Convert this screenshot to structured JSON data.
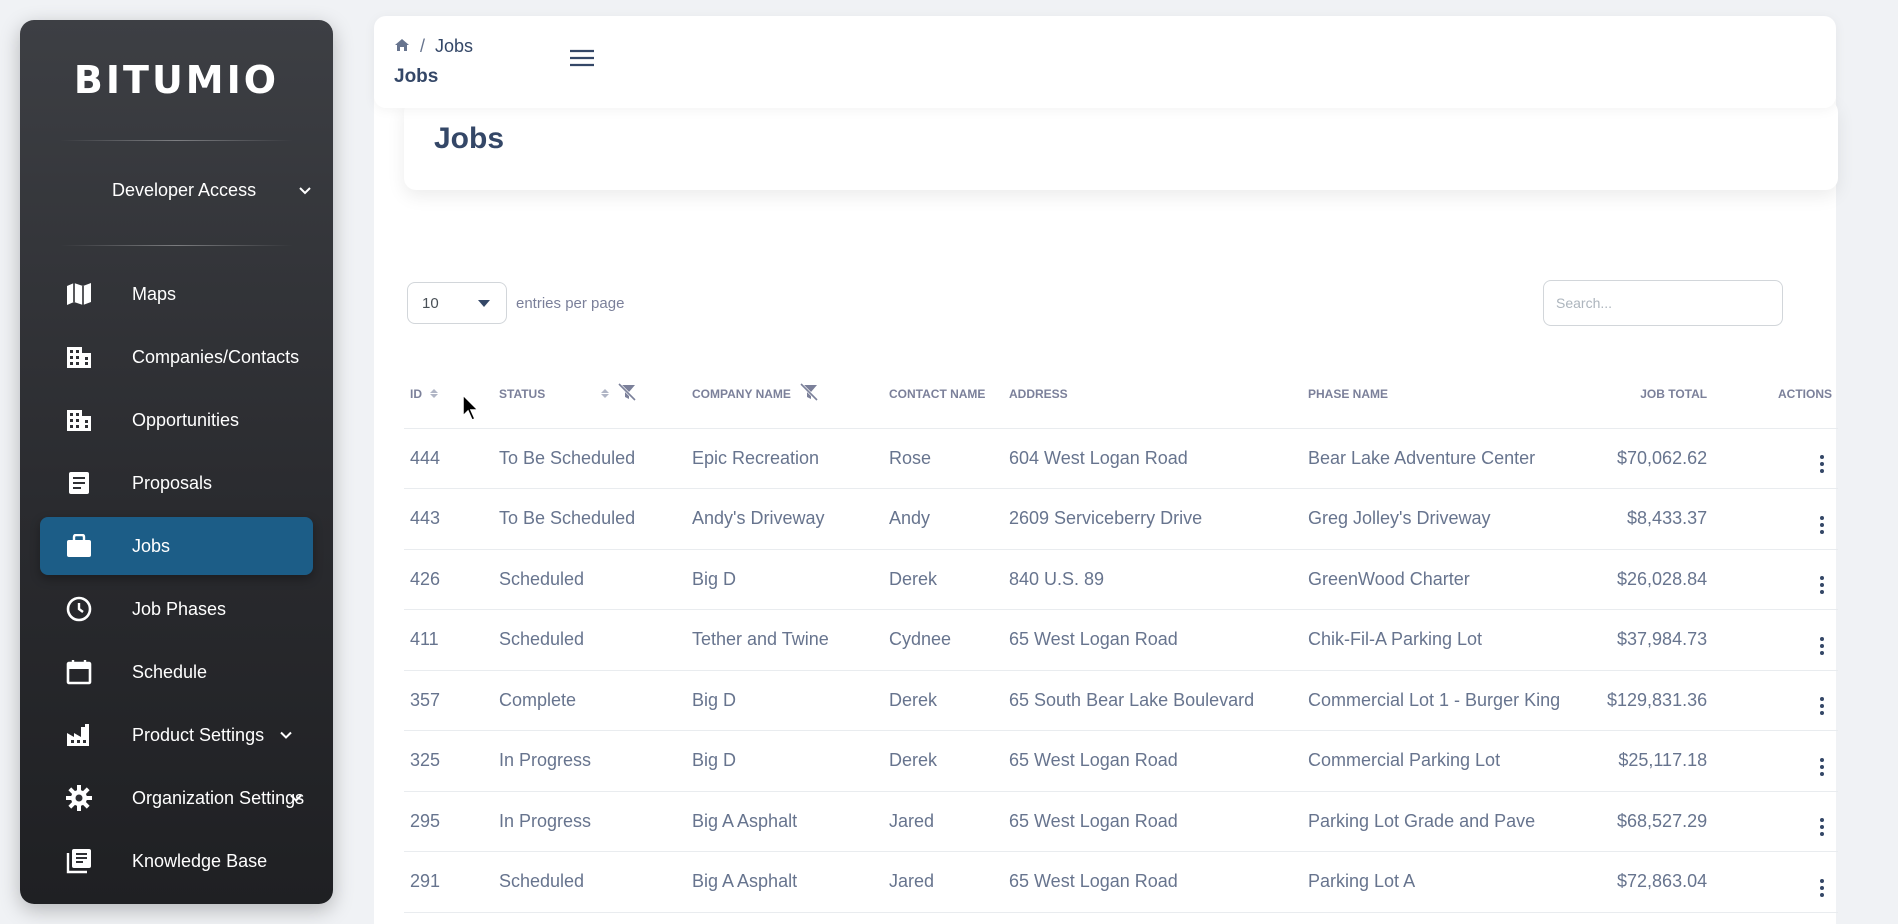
{
  "sidebar": {
    "brand": "BITUMIO",
    "access": {
      "label": "Developer Access"
    },
    "items": [
      {
        "label": "Maps",
        "icon": "map-icon"
      },
      {
        "label": "Companies/Contacts",
        "icon": "building-icon"
      },
      {
        "label": "Opportunities",
        "icon": "building-icon"
      },
      {
        "label": "Proposals",
        "icon": "document-icon"
      },
      {
        "label": "Jobs",
        "icon": "briefcase-icon",
        "active": true
      },
      {
        "label": "Job Phases",
        "icon": "clock-icon"
      },
      {
        "label": "Schedule",
        "icon": "calendar-icon"
      },
      {
        "label": "Product Settings",
        "icon": "factory-icon",
        "expandable": true
      },
      {
        "label": "Organization Settings",
        "icon": "gear-icon",
        "expandable": true
      },
      {
        "label": "Knowledge Base",
        "icon": "library-icon"
      }
    ]
  },
  "topbar": {
    "breadcrumb_current": "Jobs",
    "page_title": "Jobs"
  },
  "main": {
    "title": "Jobs",
    "entries_value": "10",
    "entries_label": "entries per page",
    "search_placeholder": "Search..."
  },
  "table": {
    "columns": [
      "ID",
      "STATUS",
      "COMPANY NAME",
      "CONTACT NAME",
      "ADDRESS",
      "PHASE NAME",
      "JOB TOTAL",
      "ACTIONS"
    ],
    "rows": [
      [
        "444",
        "To Be Scheduled",
        "Epic Recreation",
        "Rose",
        "604 West Logan Road",
        "Bear Lake Adventure Center",
        "$70,062.62"
      ],
      [
        "443",
        "To Be Scheduled",
        "Andy's Driveway",
        "Andy",
        "2609 Serviceberry Drive",
        "Greg Jolley's Driveway",
        "$8,433.37"
      ],
      [
        "426",
        "Scheduled",
        "Big D",
        "Derek",
        "840 U.S. 89",
        "GreenWood Charter",
        "$26,028.84"
      ],
      [
        "411",
        "Scheduled",
        "Tether and Twine",
        "Cydnee",
        "65 West Logan Road",
        "Chik-Fil-A Parking Lot",
        "$37,984.73"
      ],
      [
        "357",
        "Complete",
        "Big D",
        "Derek",
        "65 South Bear Lake Boulevard",
        "Commercial Lot 1 - Burger King",
        "$129,831.36"
      ],
      [
        "325",
        "In Progress",
        "Big D",
        "Derek",
        "65 West Logan Road",
        "Commercial Parking Lot",
        "$25,117.18"
      ],
      [
        "295",
        "In Progress",
        "Big A Asphalt",
        "Jared",
        "65 West Logan Road",
        "Parking Lot Grade and Pave",
        "$68,527.29"
      ],
      [
        "291",
        "Scheduled",
        "Big A Asphalt",
        "Jared",
        "65 West Logan Road",
        "Parking Lot A",
        "$72,863.04"
      ]
    ]
  },
  "colors": {
    "accent": "#1c5d87",
    "text": "#344767",
    "muted": "#67748e"
  }
}
